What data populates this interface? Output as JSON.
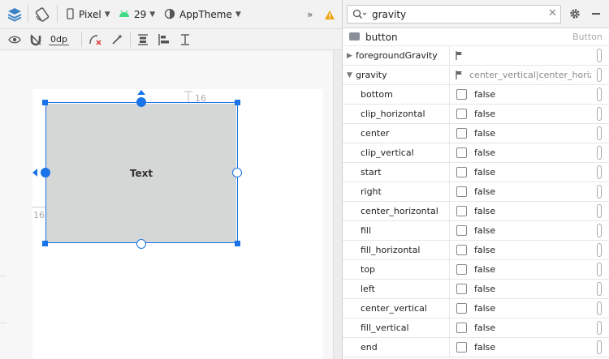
{
  "toolbar": {
    "device": "Pixel",
    "api_level": "29",
    "theme": "AppTheme",
    "more": "»",
    "margin_value": "0dp"
  },
  "canvas": {
    "widget_text": "Text",
    "margin_top": "16",
    "margin_left": "16"
  },
  "panel": {
    "search_value": "gravity",
    "component_name": "button",
    "component_type": "Button",
    "attributes": [
      {
        "name": "foregroundGravity",
        "value": "",
        "expanded": false
      },
      {
        "name": "gravity",
        "value": "center_vertical|center_horizontal",
        "expanded": true
      }
    ],
    "gravity_flags": [
      {
        "name": "bottom",
        "value": "false"
      },
      {
        "name": "clip_horizontal",
        "value": "false"
      },
      {
        "name": "center",
        "value": "false"
      },
      {
        "name": "clip_vertical",
        "value": "false"
      },
      {
        "name": "start",
        "value": "false"
      },
      {
        "name": "right",
        "value": "false"
      },
      {
        "name": "center_horizontal",
        "value": "false"
      },
      {
        "name": "fill",
        "value": "false"
      },
      {
        "name": "fill_horizontal",
        "value": "false"
      },
      {
        "name": "top",
        "value": "false"
      },
      {
        "name": "left",
        "value": "false"
      },
      {
        "name": "center_vertical",
        "value": "false"
      },
      {
        "name": "fill_vertical",
        "value": "false"
      },
      {
        "name": "end",
        "value": "false"
      }
    ]
  },
  "colors": {
    "accent": "#1a73e8",
    "warning": "#f0a30a",
    "android_green": "#3ddc84"
  }
}
